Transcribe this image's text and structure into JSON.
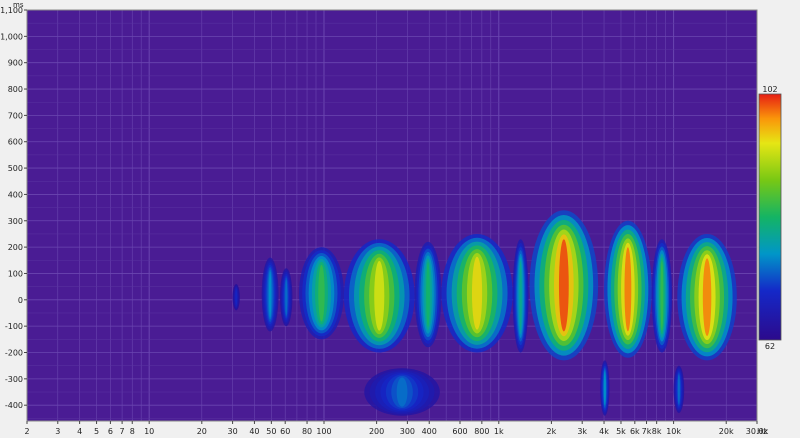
{
  "chart_data": {
    "type": "heatmap",
    "title": "",
    "xlabel": "Hz",
    "ylabel": "ms",
    "x_scale": "log",
    "xlim": [
      2,
      30000
    ],
    "ylim": [
      -460,
      1100
    ],
    "x_ticks": [
      {
        "value": 2,
        "label": "2"
      },
      {
        "value": 3,
        "label": "3"
      },
      {
        "value": 4,
        "label": "4"
      },
      {
        "value": 5,
        "label": "5"
      },
      {
        "value": 6,
        "label": "6"
      },
      {
        "value": 7,
        "label": "7"
      },
      {
        "value": 8,
        "label": "8"
      },
      {
        "value": 10,
        "label": "10"
      },
      {
        "value": 20,
        "label": "20"
      },
      {
        "value": 30,
        "label": "30"
      },
      {
        "value": 40,
        "label": "40"
      },
      {
        "value": 50,
        "label": "50"
      },
      {
        "value": 60,
        "label": "60"
      },
      {
        "value": 80,
        "label": "80"
      },
      {
        "value": 100,
        "label": "100"
      },
      {
        "value": 200,
        "label": "200"
      },
      {
        "value": 300,
        "label": "300"
      },
      {
        "value": 400,
        "label": "400"
      },
      {
        "value": 600,
        "label": "600"
      },
      {
        "value": 800,
        "label": "800"
      },
      {
        "value": 1000,
        "label": "1k"
      },
      {
        "value": 2000,
        "label": "2k"
      },
      {
        "value": 3000,
        "label": "3k"
      },
      {
        "value": 4000,
        "label": "4k"
      },
      {
        "value": 5000,
        "label": "5k"
      },
      {
        "value": 6000,
        "label": "6k"
      },
      {
        "value": 7000,
        "label": "7k"
      },
      {
        "value": 8000,
        "label": "8k"
      },
      {
        "value": 10000,
        "label": "10k"
      },
      {
        "value": 20000,
        "label": "20k"
      },
      {
        "value": 30000,
        "label": "30.0k"
      }
    ],
    "y_ticks": [
      {
        "value": 1100,
        "label": "1,100"
      },
      {
        "value": 1000,
        "label": "1,000"
      },
      {
        "value": 900,
        "label": "900"
      },
      {
        "value": 800,
        "label": "800"
      },
      {
        "value": 700,
        "label": "700"
      },
      {
        "value": 600,
        "label": "600"
      },
      {
        "value": 500,
        "label": "500"
      },
      {
        "value": 400,
        "label": "400"
      },
      {
        "value": 300,
        "label": "300"
      },
      {
        "value": 200,
        "label": "200"
      },
      {
        "value": 100,
        "label": "100"
      },
      {
        "value": 0,
        "label": "0"
      },
      {
        "value": -100,
        "label": "-100"
      },
      {
        "value": -200,
        "label": "-200"
      },
      {
        "value": -300,
        "label": "-300"
      },
      {
        "value": -400,
        "label": "-400"
      }
    ],
    "colorbar": {
      "min": 62,
      "max": 102,
      "max_label": "102",
      "min_label": "62"
    },
    "grid": true,
    "background_color": "#4a1c94",
    "blobs": [
      {
        "f_lo": 30,
        "f_hi": 33,
        "t_top": 60,
        "t_bot": -40,
        "level": 0.18
      },
      {
        "f_lo": 44,
        "f_hi": 55,
        "t_top": 160,
        "t_bot": -120,
        "level": 0.35
      },
      {
        "f_lo": 56,
        "f_hi": 66,
        "t_top": 120,
        "t_bot": -100,
        "level": 0.3
      },
      {
        "f_lo": 72,
        "f_hi": 130,
        "t_top": 200,
        "t_bot": -150,
        "level": 0.55
      },
      {
        "f_lo": 130,
        "f_hi": 330,
        "t_top": 230,
        "t_bot": -200,
        "level": 0.78
      },
      {
        "f_lo": 330,
        "f_hi": 470,
        "t_top": 220,
        "t_bot": -180,
        "level": 0.5
      },
      {
        "f_lo": 470,
        "f_hi": 1200,
        "t_top": 250,
        "t_bot": -200,
        "level": 0.82
      },
      {
        "f_lo": 1200,
        "f_hi": 1480,
        "t_top": 230,
        "t_bot": -200,
        "level": 0.45
      },
      {
        "f_lo": 1500,
        "f_hi": 3700,
        "t_top": 340,
        "t_bot": -230,
        "level": 0.97
      },
      {
        "f_lo": 4000,
        "f_hi": 7500,
        "t_top": 300,
        "t_bot": -220,
        "level": 0.93
      },
      {
        "f_lo": 7500,
        "f_hi": 9800,
        "t_top": 230,
        "t_bot": -200,
        "level": 0.55
      },
      {
        "f_lo": 10500,
        "f_hi": 23000,
        "t_top": 250,
        "t_bot": -230,
        "level": 0.92
      },
      {
        "f_lo": 170,
        "f_hi": 460,
        "t_top": -260,
        "t_bot": -440,
        "level": 0.3
      },
      {
        "f_lo": 3800,
        "f_hi": 4300,
        "t_top": -230,
        "t_bot": -440,
        "level": 0.35
      },
      {
        "f_lo": 10000,
        "f_hi": 11500,
        "t_top": -250,
        "t_bot": -430,
        "level": 0.3
      }
    ]
  }
}
